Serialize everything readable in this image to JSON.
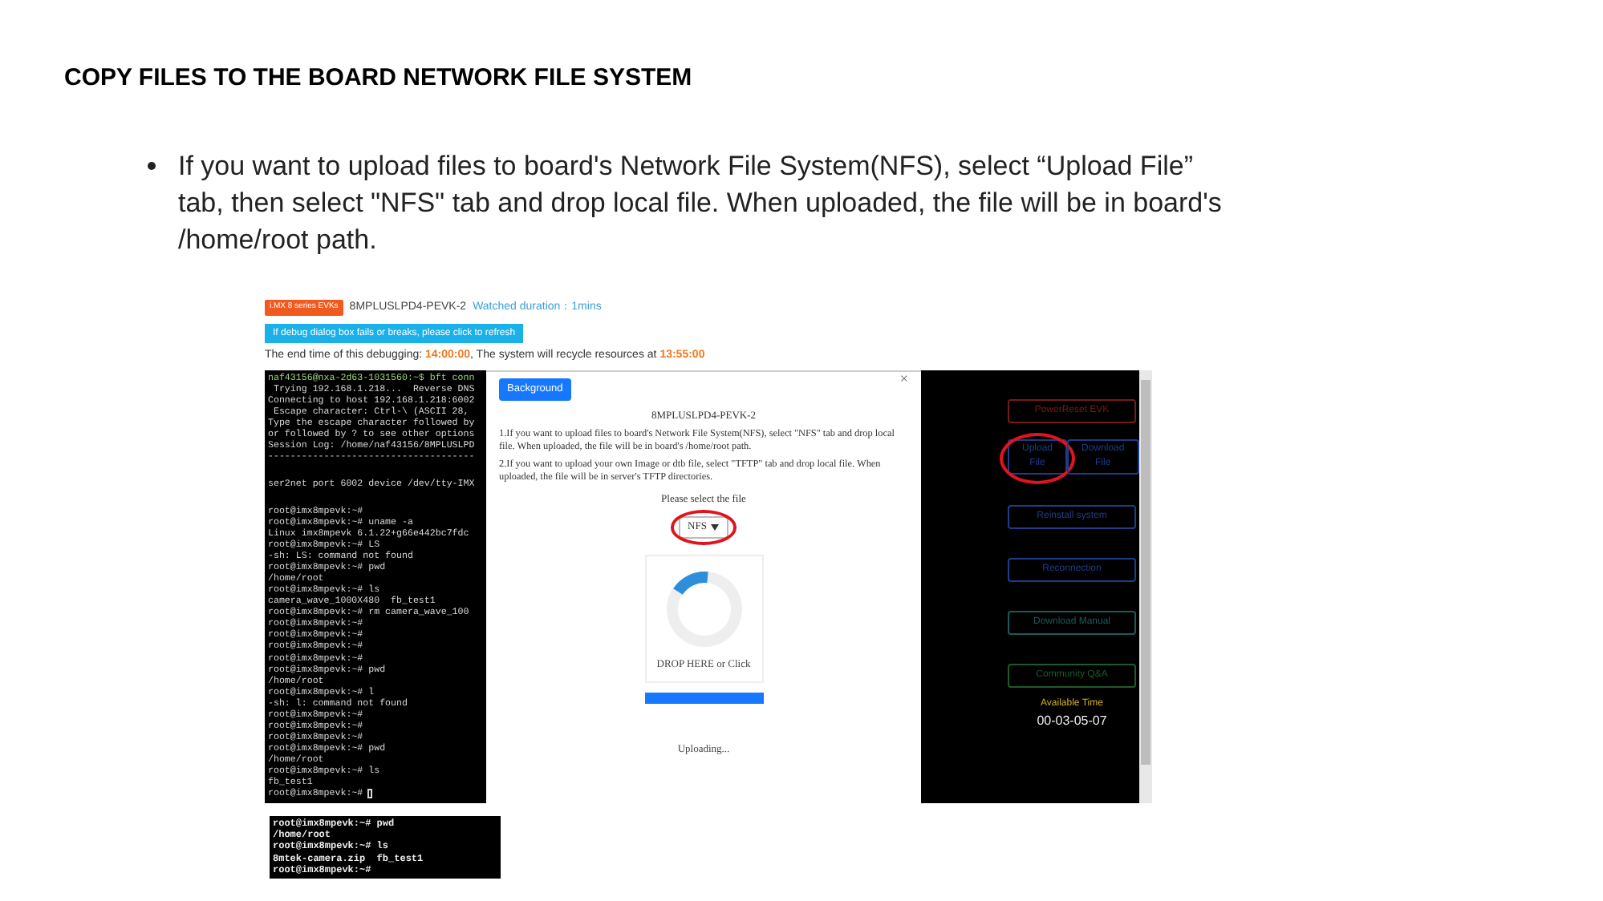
{
  "slide": {
    "title": "COPY FILES TO THE BOARD NETWORK FILE SYSTEM",
    "bullets": [
      "If you want to upload files to board's Network File System(NFS), select “Upload File” tab, then select \"NFS\" tab and drop local file. When uploaded, the file will be in board's /home/root path."
    ]
  },
  "portal": {
    "badge": "i.MX 8 series EVKs",
    "board": "8MPLUSLPD4-PEVK-2",
    "watched": "Watched duration：1mins",
    "refresh_button": "If debug dialog box fails or breaks, please click to refresh",
    "end_prefix": "The end time of this debugging: ",
    "end_time": "14:00:00",
    "end_middle": ", The system will recycle resources at ",
    "recycle_time": "13:55:00"
  },
  "terminal": {
    "blocks": [
      [
        "naf43156@nxa-2d63-1031560:~$ bft conn",
        " Trying 192.168.1.218...  Reverse DNS",
        "Connecting to host 192.168.1.218:6002",
        " Escape character: Ctrl-\\ (ASCII 28,",
        "Type the escape character followed by",
        "or followed by ? to see other options",
        "Session Log: /home/naf43156/8MPLUSLPD",
        "-------------------------------------"
      ],
      [
        "ser2net port 6002 device /dev/tty-IMX"
      ],
      [
        "root@imx8mpevk:~#",
        "root@imx8mpevk:~# uname -a",
        "Linux imx8mpevk 6.1.22+g66e442bc7fdc",
        "root@imx8mpevk:~# LS",
        "-sh: LS: command not found",
        "root@imx8mpevk:~# pwd",
        "/home/root",
        "root@imx8mpevk:~# ls",
        "camera_wave_1000X480  fb_test1",
        "root@imx8mpevk:~# rm camera_wave_100",
        "root@imx8mpevk:~#",
        "root@imx8mpevk:~#",
        "root@imx8mpevk:~#",
        "root@imx8mpevk:~#",
        "root@imx8mpevk:~# pwd",
        "/home/root",
        "root@imx8mpevk:~# l",
        "-sh: l: command not found",
        "root@imx8mpevk:~#",
        "root@imx8mpevk:~#",
        "root@imx8mpevk:~#",
        "root@imx8mpevk:~# pwd",
        "/home/root",
        "root@imx8mpevk:~# ls",
        "fb_test1",
        "root@imx8mpevk:~#"
      ]
    ]
  },
  "dialog": {
    "close": "×",
    "background_button": "Background",
    "title": "8MPLUSLPD4-PEVK-2",
    "paragraphs": [
      "1.If you want to upload files to board's Network File System(NFS), select \"NFS\" tab and drop local file. When uploaded, the file will be in board's /home/root path.",
      "2.If you want to upload your own Image or dtb file, select \"TFTP\" tab and drop local file. When uploaded, the file will be in server's TFTP directories."
    ],
    "select_label": "Please select the file",
    "select": {
      "value": "NFS",
      "circled": true
    },
    "drop_text": "DROP HERE or Click",
    "progress": {
      "level": 1
    },
    "status": "Uploading..."
  },
  "side_panel": {
    "rows": [
      [
        {
          "label": "PowerReset EVK",
          "color": "#7a1a1a",
          "circled": false
        }
      ],
      [
        {
          "label": "Upload File",
          "color": "#1d3d8a",
          "circled": true
        },
        {
          "label": "Download File",
          "color": "#1d3d8a",
          "circled": false
        }
      ],
      [
        {
          "label": "Reinstall system",
          "color": "#1d3d8a",
          "circled": false
        }
      ],
      [
        {
          "label": "Reconnection",
          "color": "#1d3d8a",
          "circled": false
        }
      ],
      [
        {
          "label": "Download Manual",
          "color": "#1e5a5a",
          "circled": false
        }
      ],
      [
        {
          "label": "Community Q&A",
          "color": "#1e5a2a",
          "circled": false
        }
      ]
    ],
    "available_label": "Available Time",
    "available_time": "00-03-05-07"
  },
  "terminal_snippet": {
    "lines": [
      "root@imx8mpevk:~# pwd",
      "/home/root",
      "root@imx8mpevk:~# ls",
      "8mtek-camera.zip  fb_test1",
      "root@imx8mpevk:~#"
    ]
  }
}
